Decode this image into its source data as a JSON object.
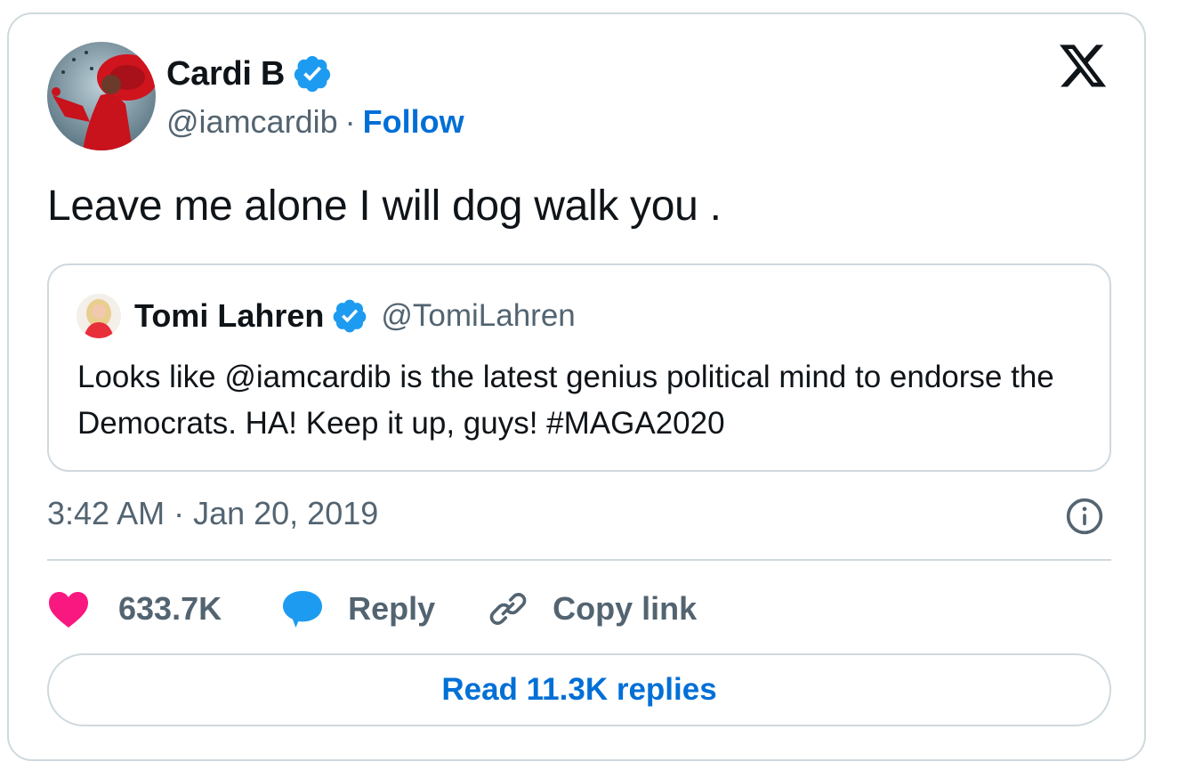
{
  "tweet": {
    "author": {
      "display_name": "Cardi B",
      "handle": "@iamcardib",
      "separator": "·",
      "follow_label": "Follow",
      "verified": true
    },
    "text": "Leave me alone I will dog walk you .",
    "quoted_tweet": {
      "display_name": "Tomi Lahren",
      "handle": "@TomiLahren",
      "verified": true,
      "text": "Looks like @iamcardib is the latest genius political mind to endorse the Democrats. HA! Keep it up, guys! #MAGA2020"
    },
    "timestamp": "3:42 AM · Jan 20, 2019",
    "actions": {
      "like_count": "633.7K",
      "reply_label": "Reply",
      "copy_link_label": "Copy link"
    },
    "read_replies_label": "Read 11.3K replies"
  },
  "icons": {
    "brand": "x-logo-icon",
    "verified": "verified-badge-icon",
    "info": "info-icon",
    "like": "heart-icon",
    "reply": "speech-bubble-icon",
    "copy": "link-icon"
  },
  "colors": {
    "accent_blue": "#006fd6",
    "verified_blue": "#1d9bf0",
    "like_pink": "#f91880",
    "muted_text": "#536471",
    "border": "#cfd9de"
  }
}
